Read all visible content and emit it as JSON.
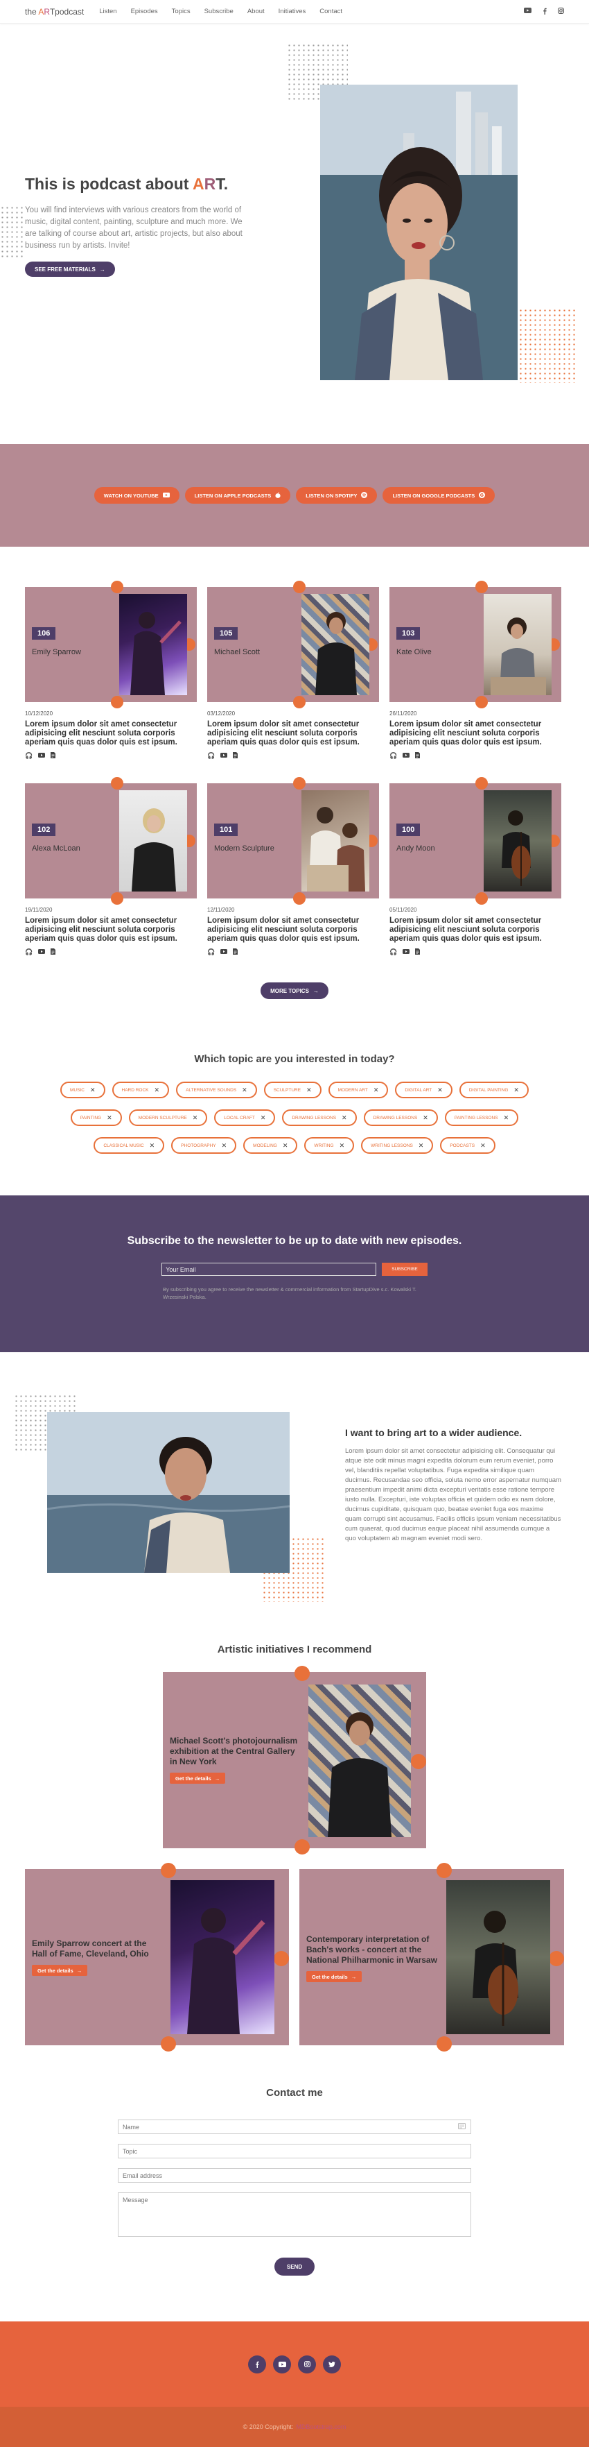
{
  "nav": {
    "brand_pre": "the ",
    "brand_a1": "A",
    "brand_a2": "R",
    "brand_a3": "T",
    "brand_post": "podcast",
    "links": [
      "Listen",
      "Episodes",
      "Topics",
      "Subscribe",
      "About",
      "Initiatives",
      "Contact"
    ],
    "social_icons": [
      "youtube-icon",
      "facebook-icon",
      "instagram-icon"
    ]
  },
  "hero": {
    "title_pre": "This is podcast about ",
    "title_a": "A",
    "title_r": "R",
    "title_t": "T.",
    "description": "You will find interviews with various creators from the world of music, digital content, painting, sculpture and much more. We are talking of course about art, artistic projects, but also about business run by artists. Invite!",
    "button": "SEE FREE MATERIALS",
    "button_icon": "arrow-right-icon"
  },
  "platforms": [
    {
      "label": "WATCH ON YOUTUBE",
      "icon": "youtube-icon"
    },
    {
      "label": "LISTEN ON APPLE PODCASTS",
      "icon": "apple-icon"
    },
    {
      "label": "LISTEN ON SPOTIFY",
      "icon": "spotify-icon"
    },
    {
      "label": "LISTEN ON GOOGLE PODCASTS",
      "icon": "google-icon"
    }
  ],
  "episodes": [
    {
      "number": "106",
      "name": "Emily Sparrow",
      "date": "10/12/2020",
      "title": "Lorem ipsum dolor sit amet consectetur adipisicing elit nesciunt soluta corporis aperiam quis quas dolor quis est ipsum."
    },
    {
      "number": "105",
      "name": "Michael Scott",
      "date": "03/12/2020",
      "title": "Lorem ipsum dolor sit amet consectetur adipisicing elit nesciunt soluta corporis aperiam quis quas dolor quis est ipsum."
    },
    {
      "number": "103",
      "name": "Kate Olive",
      "date": "26/11/2020",
      "title": "Lorem ipsum dolor sit amet consectetur adipisicing elit nesciunt soluta corporis aperiam quis quas dolor quis est ipsum."
    },
    {
      "number": "102",
      "name": "Alexa McLoan",
      "date": "19/11/2020",
      "title": "Lorem ipsum dolor sit amet consectetur adipisicing elit nesciunt soluta corporis aperiam quis quas dolor quis est ipsum."
    },
    {
      "number": "101",
      "name": "Modern Sculpture",
      "date": "12/11/2020",
      "title": "Lorem ipsum dolor sit amet consectetur adipisicing elit nesciunt soluta corporis aperiam quis quas dolor quis est ipsum."
    },
    {
      "number": "100",
      "name": "Andy Moon",
      "date": "05/11/2020",
      "title": "Lorem ipsum dolor sit amet consectetur adipisicing elit nesciunt soluta corporis aperiam quis quas dolor quis est ipsum."
    }
  ],
  "episode_icons": [
    "headphones-icon",
    "youtube-icon",
    "document-icon"
  ],
  "more_topics": "MORE TOPICS",
  "topics": {
    "title": "Which topic are you interested in today?",
    "chips": [
      "MUSIC",
      "HARD ROCK",
      "ALTERNATIVE SOUNDS",
      "SCULPTURE",
      "MODERN ART",
      "DIGITAL ART",
      "DIGITAL PAINTING",
      "PAINTING",
      "MODERN SCULPTURE",
      "LOCAL CRAFT",
      "DRAWING LESSONS",
      "DRAWING LESSONS",
      "PAINTING LESSONS",
      "CLASSICAL MUSIC",
      "PHOTOGRAPHY",
      "MODELING",
      "WRITING",
      "WRITING LESSONS",
      "PODCASTS"
    ]
  },
  "newsletter": {
    "title": "Subscribe to the newsletter to be up to date with new episodes.",
    "placeholder": "Your Email",
    "button": "SUBSCRIBE",
    "note": "By subscribing you agree to receive the newsletter & commercial information from StartupDive s.c. Kowalski T. Wrzesinski Polska."
  },
  "about": {
    "title": "I want to bring art to a wider audience.",
    "description": "Lorem ipsum dolor sit amet consectetur adipisicing elit. Consequatur qui atque iste odit minus magni expedita dolorum eum rerum eveniet, porro vel, blanditiis repellat voluptatibus. Fuga expedita similique quam ducimus. Recusandae seo officia, soluta nemo error aspernatur numquam praesentium impedit animi dicta excepturi veritatis esse ratione tempore iusto nulla. Excepturi, iste voluptas officia et quidem odio ex nam dolore, ducimus cupiditate, quisquam quo, beatae eveniet fuga eos maxime quam corrupti sint accusamus. Facilis officiis ipsum veniam necessitatibus cum quaerat, quod ducimus eaque placeat nihil assumenda cumque a quo voluptatem ab magnam eveniet modi sero."
  },
  "initiatives": {
    "title": "Artistic initiatives I recommend",
    "button": "Get the details",
    "items": [
      {
        "title": "Michael Scott's photojournalism exhibition at the Central Gallery in New York"
      },
      {
        "title": "Emily Sparrow concert at the Hall of Fame, Cleveland, Ohio"
      },
      {
        "title": "Contemporary interpretation of Bach's works - concert at the National Philharmonic in Warsaw"
      }
    ]
  },
  "contact": {
    "title": "Contact me",
    "name_placeholder": "Name",
    "topic_placeholder": "Topic",
    "email_placeholder": "Email address",
    "message_placeholder": "Message",
    "send": "SEND"
  },
  "footer": {
    "social_icons": [
      "facebook-icon",
      "youtube-icon",
      "instagram-icon",
      "twitter-icon"
    ],
    "copyright": "© 2020 Copyright:",
    "copyright_link": "MDBootstrap.com"
  },
  "colors": {
    "accent": "#e8713a",
    "orange_bg": "#e6633d",
    "mauve": "#b58a93",
    "purple": "#54466b",
    "dark_purple": "#4e3e68"
  }
}
